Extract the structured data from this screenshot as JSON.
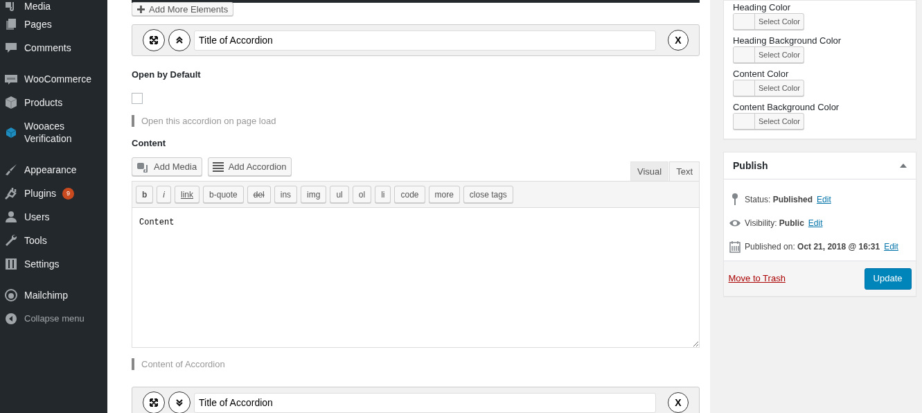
{
  "sidebar": {
    "groups": [
      [
        {
          "label": "Media"
        },
        {
          "label": "Pages"
        },
        {
          "label": "Comments"
        }
      ],
      [
        {
          "label": "WooCommerce"
        },
        {
          "label": "Products"
        },
        {
          "label": "Wooaces Verification"
        }
      ],
      [
        {
          "label": "Appearance"
        },
        {
          "label": "Plugins",
          "badge": "9"
        },
        {
          "label": "Users"
        },
        {
          "label": "Tools"
        },
        {
          "label": "Settings"
        }
      ],
      [
        {
          "label": "Mailchimp",
          "kind": "item"
        },
        {
          "label": "Collapse menu",
          "kind": "collapse"
        }
      ]
    ]
  },
  "main": {
    "add_more_button": "Add More Elements",
    "accordions": [
      {
        "title": "Title of Accordion",
        "expanded": true,
        "open_by_default": {
          "label": "Open by Default",
          "checked": false,
          "hint": "Open this accordion on page load"
        },
        "content": {
          "label": "Content",
          "media_buttons": [
            "Add Media",
            "Add Accordion"
          ],
          "tabs": [
            {
              "label": "Visual",
              "selected": false
            },
            {
              "label": "Text",
              "selected": true
            }
          ],
          "quicktags": [
            {
              "label": "b",
              "kind": "bold"
            },
            {
              "label": "i",
              "kind": "italic"
            },
            {
              "label": "link",
              "kind": "underline"
            },
            {
              "label": "b-quote",
              "kind": "plain"
            },
            {
              "label": "del",
              "kind": "strike"
            },
            {
              "label": "ins",
              "kind": "plain"
            },
            {
              "label": "img",
              "kind": "plain"
            },
            {
              "label": "ul",
              "kind": "plain"
            },
            {
              "label": "ol",
              "kind": "plain"
            },
            {
              "label": "li",
              "kind": "plain"
            },
            {
              "label": "code",
              "kind": "plain"
            },
            {
              "label": "more",
              "kind": "plain"
            },
            {
              "label": "close tags",
              "kind": "plain"
            }
          ],
          "value": "Content",
          "hint": "Content of Accordion"
        },
        "remove_button": "X"
      },
      {
        "title": "Title of Accordion",
        "expanded": false,
        "remove_button": "X"
      }
    ]
  },
  "color_settings": [
    {
      "label": "Heading Color",
      "button": "Select Color"
    },
    {
      "label": "Heading Background Color",
      "button": "Select Color"
    },
    {
      "label": "Content Color",
      "button": "Select Color"
    },
    {
      "label": "Content Background Color",
      "button": "Select Color"
    }
  ],
  "publish": {
    "title": "Publish",
    "rows": [
      {
        "kind": "status",
        "label": "Status:",
        "value": "Published",
        "link": "Edit"
      },
      {
        "kind": "visibility",
        "label": "Visibility:",
        "value": "Public",
        "link": "Edit"
      },
      {
        "kind": "date",
        "label": "Published on:",
        "value": "Oct 21, 2018 @ 16:31",
        "link": "Edit"
      }
    ],
    "trash_link": "Move to Trash",
    "update_button": "Update"
  }
}
